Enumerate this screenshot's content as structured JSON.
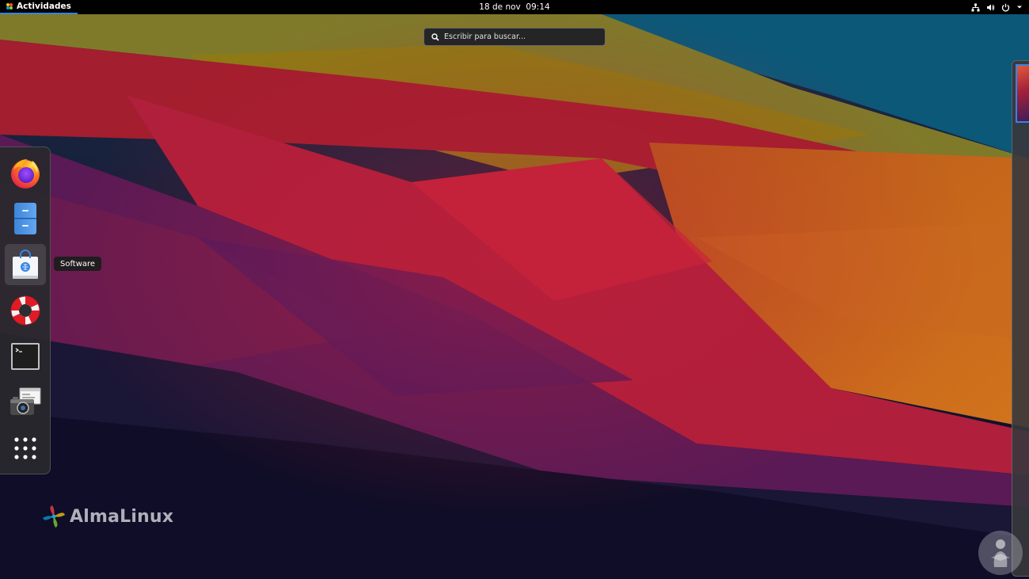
{
  "topbar": {
    "activities_label": "Actividades",
    "datetime": "18 de nov  09:14",
    "tray_icons": [
      "network-icon",
      "volume-icon",
      "power-icon",
      "chevron-down-icon"
    ]
  },
  "search": {
    "placeholder": "Escribir para buscar..."
  },
  "dash": {
    "items": [
      {
        "name": "firefox",
        "icon": "firefox-icon"
      },
      {
        "name": "files",
        "icon": "file-cabinet-icon"
      },
      {
        "name": "software",
        "icon": "shopping-bag-icon",
        "active": true
      },
      {
        "name": "help",
        "icon": "lifebuoy-icon"
      },
      {
        "name": "terminal",
        "icon": "terminal-icon"
      },
      {
        "name": "screenshot",
        "icon": "camera-icon"
      },
      {
        "name": "show-applications",
        "icon": "app-grid-icon"
      }
    ],
    "tooltip": "Software"
  },
  "branding": {
    "logo_text": "AlmaLinux"
  },
  "colors": {
    "accent": "#3584e4",
    "topbar": "#000000",
    "dash_bg": "#28282c"
  }
}
